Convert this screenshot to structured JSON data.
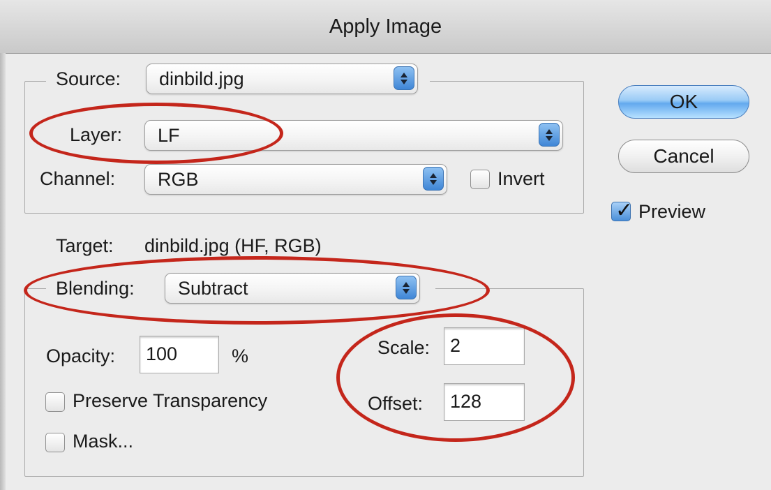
{
  "window": {
    "title": "Apply Image"
  },
  "source": {
    "label": "Source:",
    "file": "dinbild.jpg",
    "layer_label": "Layer:",
    "layer": "LF",
    "channel_label": "Channel:",
    "channel": "RGB",
    "invert_label": "Invert",
    "invert_checked": false
  },
  "target": {
    "label": "Target:",
    "value": "dinbild.jpg (HF, RGB)"
  },
  "blending": {
    "label": "Blending:",
    "mode": "Subtract",
    "opacity_label": "Opacity:",
    "opacity": "100",
    "opacity_unit": "%",
    "preserve_transparency_label": "Preserve Transparency",
    "preserve_transparency_checked": false,
    "mask_label": "Mask...",
    "mask_checked": false,
    "scale_label": "Scale:",
    "scale": "2",
    "offset_label": "Offset:",
    "offset": "128"
  },
  "buttons": {
    "ok": "OK",
    "cancel": "Cancel"
  },
  "preview": {
    "label": "Preview",
    "checked": true
  },
  "colors": {
    "annotation": "#c4261b",
    "accent": "#4a8fd9"
  }
}
